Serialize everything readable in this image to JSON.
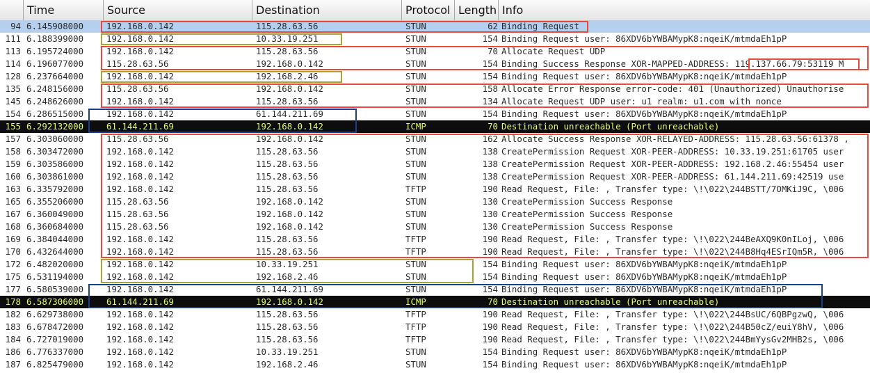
{
  "columns": {
    "no": "",
    "time": "Time",
    "source": "Source",
    "destination": "Destination",
    "protocol": "Protocol",
    "length": "Length",
    "info": "Info"
  },
  "colors": {
    "red": "#e8493a",
    "olive": "#a6a53a",
    "blue": "#1b3f8f",
    "selected": "#b5d0ee",
    "icmp_bg": "#0d0d0d",
    "icmp_text": "#e0ff6a"
  },
  "packets": [
    {
      "no": "94",
      "time": "6.145908000",
      "source": "192.168.0.142",
      "destination": "115.28.63.56",
      "protocol": "STUN",
      "length": "62",
      "info": "Binding Request",
      "style": "selected"
    },
    {
      "no": "111",
      "time": "6.188399000",
      "source": "192.168.0.142",
      "destination": "10.33.19.251",
      "protocol": "STUN",
      "length": "154",
      "info": "Binding Request user: 86XDV6bYWBAMypK8:nqeiK/mtmdaEh1pP",
      "style": "normal"
    },
    {
      "no": "113",
      "time": "6.195724000",
      "source": "192.168.0.142",
      "destination": "115.28.63.56",
      "protocol": "STUN",
      "length": "70",
      "info": "Allocate Request UDP",
      "style": "normal"
    },
    {
      "no": "114",
      "time": "6.196077000",
      "source": "115.28.63.56",
      "destination": "192.168.0.142",
      "protocol": "STUN",
      "length": "154",
      "info": "Binding Success Response XOR-MAPPED-ADDRESS: 119.137.66.79:53119 M",
      "style": "normal"
    },
    {
      "no": "128",
      "time": "6.237664000",
      "source": "192.168.0.142",
      "destination": "192.168.2.46",
      "protocol": "STUN",
      "length": "154",
      "info": "Binding Request user: 86XDV6bYWBAMypK8:nqeiK/mtmdaEh1pP",
      "style": "normal"
    },
    {
      "no": "135",
      "time": "6.248156000",
      "source": "115.28.63.56",
      "destination": "192.168.0.142",
      "protocol": "STUN",
      "length": "158",
      "info": "Allocate Error Response error-code: 401 (Unauthorized) Unauthorise",
      "style": "normal"
    },
    {
      "no": "145",
      "time": "6.248626000",
      "source": "192.168.0.142",
      "destination": "115.28.63.56",
      "protocol": "STUN",
      "length": "134",
      "info": "Allocate Request UDP user: u1 realm: u1.com with nonce",
      "style": "normal"
    },
    {
      "no": "154",
      "time": "6.286515000",
      "source": "192.168.0.142",
      "destination": "61.144.211.69",
      "protocol": "STUN",
      "length": "154",
      "info": "Binding Request user: 86XDV6bYWBAMypK8:nqeiK/mtmdaEh1pP",
      "style": "normal"
    },
    {
      "no": "155",
      "time": "6.292132000",
      "source": "61.144.211.69",
      "destination": "192.168.0.142",
      "protocol": "ICMP",
      "length": "70",
      "info": "Destination unreachable (Port unreachable)",
      "style": "dark"
    },
    {
      "no": "157",
      "time": "6.303060000",
      "source": "115.28.63.56",
      "destination": "192.168.0.142",
      "protocol": "STUN",
      "length": "162",
      "info": "Allocate Success Response XOR-RELAYED-ADDRESS: 115.28.63.56:61378 ,",
      "style": "normal"
    },
    {
      "no": "158",
      "time": "6.303472000",
      "source": "192.168.0.142",
      "destination": "115.28.63.56",
      "protocol": "STUN",
      "length": "138",
      "info": "CreatePermission Request XOR-PEER-ADDRESS: 10.33.19.251:61705 user",
      "style": "normal"
    },
    {
      "no": "159",
      "time": "6.303586000",
      "source": "192.168.0.142",
      "destination": "115.28.63.56",
      "protocol": "STUN",
      "length": "138",
      "info": "CreatePermission Request XOR-PEER-ADDRESS: 192.168.2.46:55454 user",
      "style": "normal"
    },
    {
      "no": "160",
      "time": "6.303861000",
      "source": "192.168.0.142",
      "destination": "115.28.63.56",
      "protocol": "STUN",
      "length": "138",
      "info": "CreatePermission Request XOR-PEER-ADDRESS: 61.144.211.69:42519 use",
      "style": "normal"
    },
    {
      "no": "163",
      "time": "6.335792000",
      "source": "192.168.0.142",
      "destination": "115.28.63.56",
      "protocol": "TFTP",
      "length": "190",
      "info": "Read Request, File: , Transfer type: \\!\\022\\244BSTT/7OMKiJ9C, \\006",
      "style": "normal"
    },
    {
      "no": "165",
      "time": "6.355206000",
      "source": "115.28.63.56",
      "destination": "192.168.0.142",
      "protocol": "STUN",
      "length": "130",
      "info": "CreatePermission Success Response",
      "style": "normal"
    },
    {
      "no": "167",
      "time": "6.360049000",
      "source": "115.28.63.56",
      "destination": "192.168.0.142",
      "protocol": "STUN",
      "length": "130",
      "info": "CreatePermission Success Response",
      "style": "normal"
    },
    {
      "no": "168",
      "time": "6.360684000",
      "source": "115.28.63.56",
      "destination": "192.168.0.142",
      "protocol": "STUN",
      "length": "130",
      "info": "CreatePermission Success Response",
      "style": "normal"
    },
    {
      "no": "169",
      "time": "6.384044000",
      "source": "192.168.0.142",
      "destination": "115.28.63.56",
      "protocol": "TFTP",
      "length": "190",
      "info": "Read Request, File: , Transfer type: \\!\\022\\244BeAXQ9K0nILoj, \\006",
      "style": "normal"
    },
    {
      "no": "170",
      "time": "6.432644000",
      "source": "192.168.0.142",
      "destination": "115.28.63.56",
      "protocol": "TFTP",
      "length": "190",
      "info": "Read Request, File: , Transfer type: \\!\\022\\244B8Hq4ESrIQm5R, \\006",
      "style": "normal"
    },
    {
      "no": "172",
      "time": "6.482020000",
      "source": "192.168.0.142",
      "destination": "10.33.19.251",
      "protocol": "STUN",
      "length": "154",
      "info": "Binding Request user: 86XDV6bYWBAMypK8:nqeiK/mtmdaEh1pP",
      "style": "normal"
    },
    {
      "no": "175",
      "time": "6.531194000",
      "source": "192.168.0.142",
      "destination": "192.168.2.46",
      "protocol": "STUN",
      "length": "154",
      "info": "Binding Request user: 86XDV6bYWBAMypK8:nqeiK/mtmdaEh1pP",
      "style": "normal"
    },
    {
      "no": "177",
      "time": "6.580539000",
      "source": "192.168.0.142",
      "destination": "61.144.211.69",
      "protocol": "STUN",
      "length": "154",
      "info": "Binding Request user: 86XDV6bYWBAMypK8:nqeiK/mtmdaEh1pP",
      "style": "normal"
    },
    {
      "no": "178",
      "time": "6.587306000",
      "source": "61.144.211.69",
      "destination": "192.168.0.142",
      "protocol": "ICMP",
      "length": "70",
      "info": "Destination unreachable (Port unreachable)",
      "style": "dark"
    },
    {
      "no": "182",
      "time": "6.629738000",
      "source": "192.168.0.142",
      "destination": "115.28.63.56",
      "protocol": "TFTP",
      "length": "190",
      "info": "Read Request, File: , Transfer type: \\!\\022\\244BsUC/6QBPgzwQ, \\006",
      "style": "normal"
    },
    {
      "no": "183",
      "time": "6.678472000",
      "source": "192.168.0.142",
      "destination": "115.28.63.56",
      "protocol": "TFTP",
      "length": "190",
      "info": "Read Request, File: , Transfer type: \\!\\022\\244B50cZ/euiY8hV, \\006",
      "style": "normal"
    },
    {
      "no": "184",
      "time": "6.727019000",
      "source": "192.168.0.142",
      "destination": "115.28.63.56",
      "protocol": "TFTP",
      "length": "190",
      "info": "Read Request, File: , Transfer type: \\!\\022\\244BmYysGv2MHB2s, \\006",
      "style": "normal"
    },
    {
      "no": "186",
      "time": "6.776337000",
      "source": "192.168.0.142",
      "destination": "10.33.19.251",
      "protocol": "STUN",
      "length": "154",
      "info": "Binding Request user: 86XDV6bYWBAMypK8:nqeiK/mtmdaEh1pP",
      "style": "normal"
    },
    {
      "no": "187",
      "time": "6.825479000",
      "source": "192.168.0.142",
      "destination": "192.168.2.46",
      "protocol": "STUN",
      "length": "154",
      "info": "Binding Request user: 86XDV6bYWBAMypK8:nqeiK/mtmdaEh1pP",
      "style": "normal"
    }
  ],
  "annotations": [
    {
      "color": "red",
      "rows": [
        0,
        0
      ],
      "from": "source",
      "to": "info-end"
    },
    {
      "color": "olive",
      "rows": [
        1,
        1
      ],
      "from": "source",
      "to": "dest-end"
    },
    {
      "color": "red",
      "rows": [
        2,
        3
      ],
      "from": "source",
      "to": "right-edge"
    },
    {
      "color": "red",
      "rows": [
        3,
        3
      ],
      "from": "mapped-address",
      "to": "mapped-address-end"
    },
    {
      "color": "olive",
      "rows": [
        4,
        4
      ],
      "from": "source",
      "to": "dest-end"
    },
    {
      "color": "red",
      "rows": [
        5,
        6
      ],
      "from": "source",
      "to": "right-edge"
    },
    {
      "color": "blue",
      "rows": [
        7,
        8
      ],
      "from": "time",
      "to": "protocol-start"
    },
    {
      "color": "red",
      "rows": [
        9,
        18
      ],
      "from": "source",
      "to": "right-edge"
    },
    {
      "color": "olive",
      "rows": [
        19,
        20
      ],
      "from": "source",
      "to": "protocol-end"
    },
    {
      "color": "blue",
      "rows": [
        21,
        22
      ],
      "from": "time",
      "to": "info-long-end"
    }
  ]
}
